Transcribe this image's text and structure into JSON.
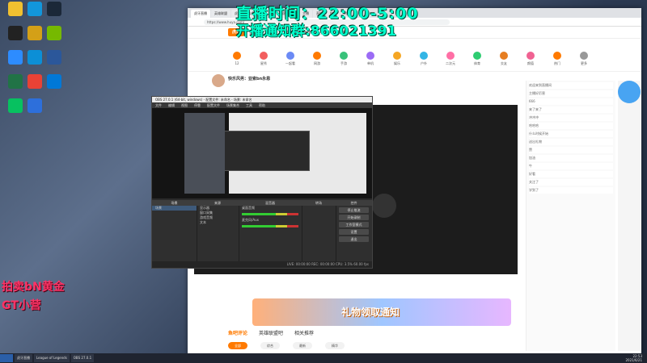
{
  "overlay": {
    "line1": "直播时间：22:00-5:00",
    "line2": "开播通知群:866021391",
    "left1": "拍卖bN黄金",
    "left2": "GT小营"
  },
  "desktop_icons": [
    {
      "label": "PUBG",
      "color": "#f0c030"
    },
    {
      "label": "QQ",
      "color": "#1296db"
    },
    {
      "label": "Steam",
      "color": "#1b2838"
    },
    {
      "label": "Epic",
      "color": "#222"
    },
    {
      "label": "PUBG LITE",
      "color": "#d4a017"
    },
    {
      "label": "GeForce",
      "color": "#76b900"
    },
    {
      "label": "Zoom",
      "color": "#2d8cff"
    },
    {
      "label": "Edge",
      "color": "#0c8fd6"
    },
    {
      "label": "Word",
      "color": "#2b579a"
    },
    {
      "label": "Excel",
      "color": "#217346"
    },
    {
      "label": "Chrome",
      "color": "#e94235"
    },
    {
      "label": "KK",
      "color": "#0078d7"
    },
    {
      "label": "WeChat",
      "color": "#07c160"
    },
    {
      "label": "Wallpaper",
      "color": "#2d6fdb"
    }
  ],
  "browser": {
    "tabs": [
      "虎牙直播",
      "英雄联盟",
      "虎牙",
      "斗鱼直播",
      "小象",
      "虎牙直播",
      "主播",
      "直播",
      "搜狗",
      "明星"
    ],
    "url": "https://www.huya.com/",
    "site_logo": "虎牙",
    "nav": [
      "首页",
      "直播",
      "分类",
      "游戏",
      "赛事",
      "更多"
    ],
    "categories": [
      "12",
      "星秀",
      "一起看",
      "网游",
      "手游",
      "单机",
      "娱乐",
      "户外",
      "二次元",
      "体育",
      "交友",
      "颜值",
      "热门",
      "更多"
    ],
    "room_title": "快乐风男：亚索bn永恩",
    "chat_rows": [
      "欢迎来到直播间",
      "主播好厉害",
      "666",
      "来了来了",
      "冲冲冲",
      "哈哈哈",
      "什么时候开始",
      "送出礼物",
      "赞",
      "加油",
      "牛",
      "好看",
      "关注了",
      "学到了"
    ],
    "banner_text": "礼物领取通知",
    "section_tabs": [
      "鱼吧评论",
      "英雄联盟吧",
      "相关推荐"
    ],
    "pills": [
      "全部",
      "综合",
      "最新",
      "精华"
    ]
  },
  "obs": {
    "title": "OBS 27.0.1 (64-bit, windows) - 配置文件: 未命名 - 场景: 未命名",
    "menu": [
      "文件",
      "编辑",
      "视图",
      "停靠",
      "配置文件",
      "场景集合",
      "工具",
      "帮助"
    ],
    "dock_titles": [
      "场景",
      "来源",
      "混音器",
      "转场",
      "控件"
    ],
    "scene": "场景",
    "sources": [
      "显示器",
      "窗口采集",
      "游戏音频",
      "文本"
    ],
    "mixer": [
      "桌面音频",
      "麦克风/Aux"
    ],
    "controls": [
      "停止推流",
      "开始录制",
      "工作室模式",
      "设置",
      "退出"
    ],
    "status": "LIVE: 00:00:00  REC: 00:00:00  CPU: 3.5%  60.00 fps"
  },
  "taskbar": {
    "items": [
      "虎牙直播",
      "League of Legends",
      "OBS 27.0.1"
    ],
    "time": "22:53",
    "date": "2021/6/21"
  }
}
